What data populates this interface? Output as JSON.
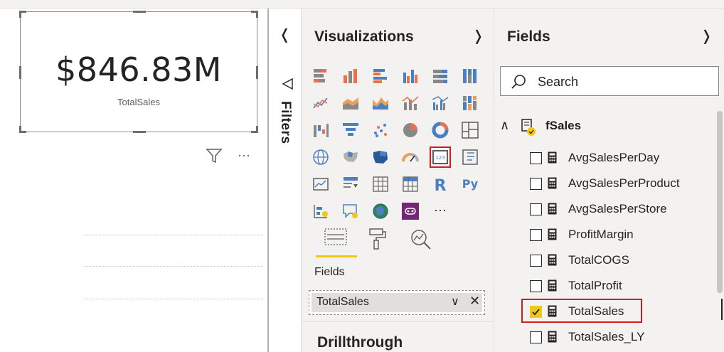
{
  "card": {
    "value": "$846.83M",
    "label": "TotalSales"
  },
  "filters": {
    "label": "Filters"
  },
  "visualizations": {
    "title": "Visualizations",
    "fields_well": {
      "label": "Fields",
      "value": "TotalSales"
    },
    "drillthrough_label": "Drillthrough"
  },
  "fields_pane": {
    "title": "Fields",
    "search_placeholder": "Search",
    "table": {
      "name": "fSales",
      "fields": [
        {
          "name": "AvgSalesPerDay",
          "checked": false
        },
        {
          "name": "AvgSalesPerProduct",
          "checked": false
        },
        {
          "name": "AvgSalesPerStore",
          "checked": false
        },
        {
          "name": "ProfitMargin",
          "checked": false
        },
        {
          "name": "TotalCOGS",
          "checked": false
        },
        {
          "name": "TotalProfit",
          "checked": false
        },
        {
          "name": "TotalSales",
          "checked": true
        },
        {
          "name": "TotalSales_LY",
          "checked": false
        }
      ]
    }
  },
  "colors": {
    "accent_yellow": "#f2c811",
    "highlight_red": "#cc1f1f",
    "pane_bg": "#f3f2f1"
  }
}
